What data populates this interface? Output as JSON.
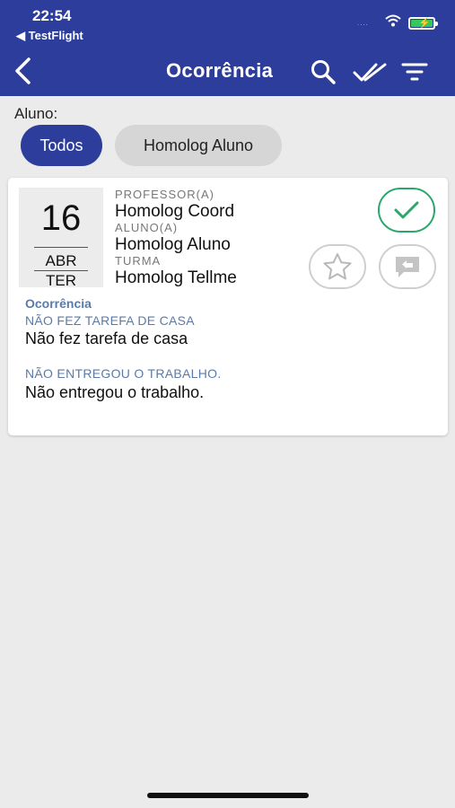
{
  "status_bar": {
    "time": "22:54",
    "back_app": "◀ TestFlight",
    "signal": "....",
    "battery_color": "#35c759"
  },
  "nav": {
    "title": "Ocorrência",
    "bar_color": "#2d3d9c",
    "icons": [
      "chevron-left-icon",
      "search-icon",
      "double-check-icon",
      "filter-icon"
    ]
  },
  "filter": {
    "label": "Aluno:",
    "chips": [
      {
        "label": "Todos",
        "selected": true
      },
      {
        "label": "Homolog Aluno",
        "selected": false
      }
    ]
  },
  "card": {
    "date": {
      "day": "16",
      "month": "ABR",
      "weekday": "TER"
    },
    "professor_label": "PROFESSOR(A)",
    "professor_value": "Homolog Coord",
    "aluno_label": "ALUNO(A)",
    "aluno_value": "Homolog Aluno",
    "turma_label": "TURMA",
    "turma_value": "Homolog Tellme",
    "section_title": "Ocorrência",
    "items": [
      {
        "label": "NÃO FEZ TAREFA DE CASA",
        "value": "Não fez tarefa de casa"
      },
      {
        "label": "NÃO ENTREGOU O TRABALHO.",
        "value": "Não entregou o trabalho."
      }
    ],
    "actions": [
      "check-icon",
      "star-icon",
      "reply-icon"
    ],
    "check_color": "#2aa86b",
    "section_color": "#5a7aa8"
  }
}
